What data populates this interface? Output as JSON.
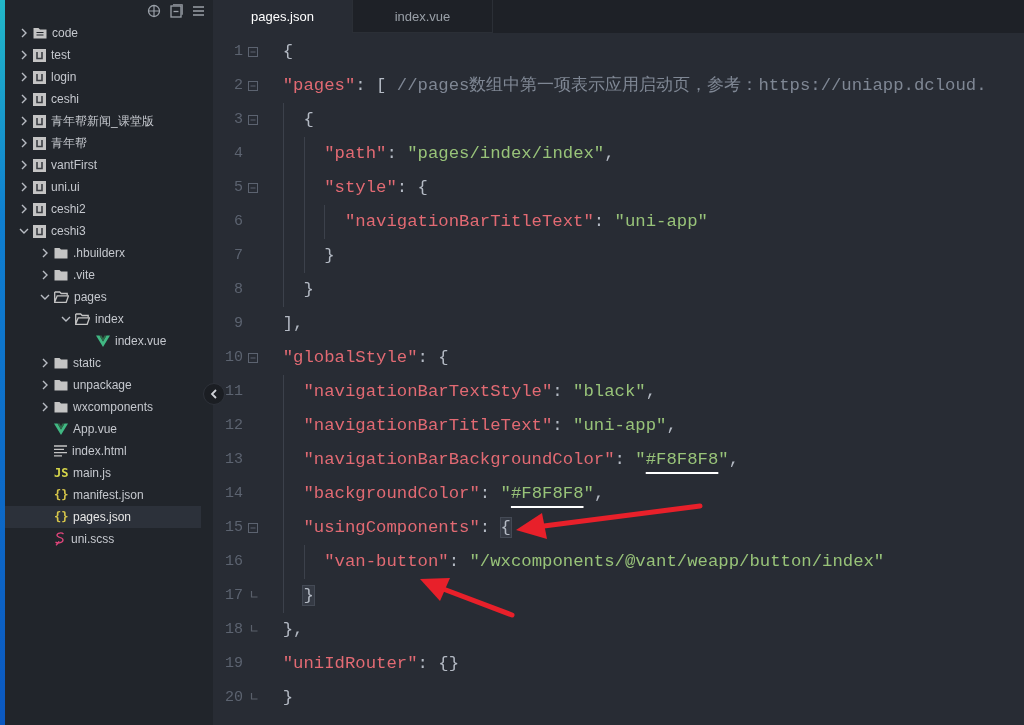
{
  "sidebar": {
    "items": [
      {
        "label": "code",
        "kind": "workspace",
        "expanded": false,
        "selected": false
      },
      {
        "label": "test",
        "kind": "project",
        "expanded": false,
        "selected": false
      },
      {
        "label": "login",
        "kind": "project",
        "expanded": false,
        "selected": false
      },
      {
        "label": "ceshi",
        "kind": "project",
        "expanded": false,
        "selected": false
      },
      {
        "label": "青年帮新闻_课堂版",
        "kind": "project",
        "expanded": false,
        "selected": false
      },
      {
        "label": "青年帮",
        "kind": "project",
        "expanded": false,
        "selected": false
      },
      {
        "label": "vantFirst",
        "kind": "project",
        "expanded": false,
        "selected": false
      },
      {
        "label": "uni.ui",
        "kind": "project",
        "expanded": false,
        "selected": false
      },
      {
        "label": "ceshi2",
        "kind": "project",
        "expanded": false,
        "selected": false
      },
      {
        "label": "ceshi3",
        "kind": "project",
        "expanded": true,
        "selected": false,
        "children": [
          {
            "label": ".hbuilderx",
            "kind": "folder",
            "expanded": false,
            "selected": false
          },
          {
            "label": ".vite",
            "kind": "folder",
            "expanded": false,
            "selected": false
          },
          {
            "label": "pages",
            "kind": "folder",
            "expanded": true,
            "selected": false,
            "children": [
              {
                "label": "index",
                "kind": "folder",
                "expanded": true,
                "selected": false,
                "children": [
                  {
                    "label": "index.vue",
                    "kind": "vue",
                    "selected": false
                  }
                ]
              }
            ]
          },
          {
            "label": "static",
            "kind": "folder",
            "expanded": false,
            "selected": false
          },
          {
            "label": "unpackage",
            "kind": "folder",
            "expanded": false,
            "selected": false
          },
          {
            "label": "wxcomponents",
            "kind": "folder",
            "expanded": false,
            "selected": false
          },
          {
            "label": "App.vue",
            "kind": "vue",
            "selected": false
          },
          {
            "label": "index.html",
            "kind": "html",
            "selected": false
          },
          {
            "label": "main.js",
            "kind": "js",
            "icon_text": "JS",
            "selected": false
          },
          {
            "label": "manifest.json",
            "kind": "json",
            "icon_text": "{}",
            "selected": false
          },
          {
            "label": "pages.json",
            "kind": "json",
            "icon_text": "{}",
            "selected": true
          },
          {
            "label": "uni.scss",
            "kind": "scss",
            "selected": false
          }
        ]
      }
    ]
  },
  "editor": {
    "tabs": [
      {
        "label": "pages.json",
        "selected": true
      },
      {
        "label": "index.vue",
        "selected": false
      }
    ],
    "lines": [
      {
        "number": "1",
        "collapsible": true,
        "block_end": false,
        "tokens": [
          {
            "kind": "punct",
            "text": "{"
          }
        ],
        "children": [
          {
            "number": "2",
            "collapsible": true,
            "block_end": false,
            "tokens": [
              {
                "kind": "key",
                "text": "\"pages\""
              },
              {
                "kind": "punct",
                "text": ": [ "
              },
              {
                "kind": "comment",
                "text": "//pages数组中第一项表示应用启动页，参考：https://uniapp.dcloud."
              }
            ],
            "children": [
              {
                "number": "3",
                "collapsible": true,
                "block_end": false,
                "tokens": [
                  {
                    "kind": "punct",
                    "text": "{"
                  }
                ],
                "children": [
                  {
                    "number": "4",
                    "collapsible": false,
                    "block_end": false,
                    "tokens": [
                      {
                        "kind": "key",
                        "text": "\"path\""
                      },
                      {
                        "kind": "punct",
                        "text": ": "
                      },
                      {
                        "kind": "string",
                        "text": "\"pages/index/index\""
                      },
                      {
                        "kind": "punct",
                        "text": ","
                      }
                    ]
                  },
                  {
                    "number": "5",
                    "collapsible": true,
                    "block_end": false,
                    "tokens": [
                      {
                        "kind": "key",
                        "text": "\"style\""
                      },
                      {
                        "kind": "punct",
                        "text": ": {"
                      }
                    ],
                    "children": [
                      {
                        "number": "6",
                        "collapsible": false,
                        "block_end": false,
                        "tokens": [
                          {
                            "kind": "key",
                            "text": "\"navigationBarTitleText\""
                          },
                          {
                            "kind": "punct",
                            "text": ": "
                          },
                          {
                            "kind": "string",
                            "text": "\"uni-app\""
                          }
                        ]
                      }
                    ]
                  },
                  {
                    "number": "7",
                    "collapsible": false,
                    "block_end": false,
                    "tokens": [
                      {
                        "kind": "punct",
                        "text": "}"
                      }
                    ]
                  }
                ]
              },
              {
                "number": "8",
                "collapsible": false,
                "block_end": false,
                "tokens": [
                  {
                    "kind": "punct",
                    "text": "}"
                  }
                ]
              }
            ]
          },
          {
            "number": "9",
            "collapsible": false,
            "block_end": false,
            "tokens": [
              {
                "kind": "punct",
                "text": "],"
              }
            ]
          },
          {
            "number": "10",
            "collapsible": true,
            "block_end": false,
            "tokens": [
              {
                "kind": "key",
                "text": "\"globalStyle\""
              },
              {
                "kind": "punct",
                "text": ": {"
              }
            ],
            "children": [
              {
                "number": "11",
                "collapsible": false,
                "block_end": false,
                "tokens": [
                  {
                    "kind": "key",
                    "text": "\"navigationBarTextStyle\""
                  },
                  {
                    "kind": "punct",
                    "text": ": "
                  },
                  {
                    "kind": "string",
                    "text": "\"black\""
                  },
                  {
                    "kind": "punct",
                    "text": ","
                  }
                ]
              },
              {
                "number": "12",
                "collapsible": false,
                "block_end": false,
                "tokens": [
                  {
                    "kind": "key",
                    "text": "\"navigationBarTitleText\""
                  },
                  {
                    "kind": "punct",
                    "text": ": "
                  },
                  {
                    "kind": "string",
                    "text": "\"uni-app\""
                  },
                  {
                    "kind": "punct",
                    "text": ","
                  }
                ]
              },
              {
                "number": "13",
                "collapsible": false,
                "block_end": false,
                "tokens": [
                  {
                    "kind": "key",
                    "text": "\"navigationBarBackgroundColor\""
                  },
                  {
                    "kind": "punct",
                    "text": ": "
                  },
                  {
                    "kind": "string",
                    "text": "\""
                  },
                  {
                    "kind": "string",
                    "text": "#F8F8F8",
                    "underlined": true
                  },
                  {
                    "kind": "string",
                    "text": "\""
                  },
                  {
                    "kind": "punct",
                    "text": ","
                  }
                ]
              },
              {
                "number": "14",
                "collapsible": false,
                "block_end": false,
                "tokens": [
                  {
                    "kind": "key",
                    "text": "\"backgroundColor\""
                  },
                  {
                    "kind": "punct",
                    "text": ": "
                  },
                  {
                    "kind": "string",
                    "text": "\""
                  },
                  {
                    "kind": "string",
                    "text": "#F8F8F8",
                    "underlined": true
                  },
                  {
                    "kind": "string",
                    "text": "\""
                  },
                  {
                    "kind": "punct",
                    "text": ","
                  }
                ]
              },
              {
                "number": "15",
                "collapsible": true,
                "block_end": false,
                "tokens": [
                  {
                    "kind": "key",
                    "text": "\"usingComponents\""
                  },
                  {
                    "kind": "punct",
                    "text": ": "
                  },
                  {
                    "kind": "punct",
                    "text": "{",
                    "highlighted": true,
                    "arrow": true
                  }
                ],
                "children": [
                  {
                    "number": "16",
                    "collapsible": false,
                    "block_end": false,
                    "tokens": [
                      {
                        "kind": "key",
                        "text": "\"van-button\"",
                        "arrow": true
                      },
                      {
                        "kind": "punct",
                        "text": ": "
                      },
                      {
                        "kind": "string",
                        "text": "\"/wxcomponents/@vant/weapp/button/index\""
                      }
                    ]
                  }
                ]
              },
              {
                "number": "17",
                "collapsible": false,
                "block_end": true,
                "tokens": [
                  {
                    "kind": "punct",
                    "text": "}",
                    "highlighted": true
                  }
                ]
              }
            ]
          },
          {
            "number": "18",
            "collapsible": false,
            "block_end": true,
            "tokens": [
              {
                "kind": "punct",
                "text": "},"
              }
            ]
          },
          {
            "number": "19",
            "collapsible": false,
            "block_end": false,
            "tokens": [
              {
                "kind": "key",
                "text": "\"uniIdRouter\""
              },
              {
                "kind": "punct",
                "text": ": "
              },
              {
                "kind": "punct",
                "text": "{}"
              }
            ]
          }
        ]
      },
      {
        "number": "20",
        "collapsible": false,
        "block_end": true,
        "tokens": [
          {
            "kind": "punct",
            "text": "}"
          }
        ]
      }
    ]
  }
}
